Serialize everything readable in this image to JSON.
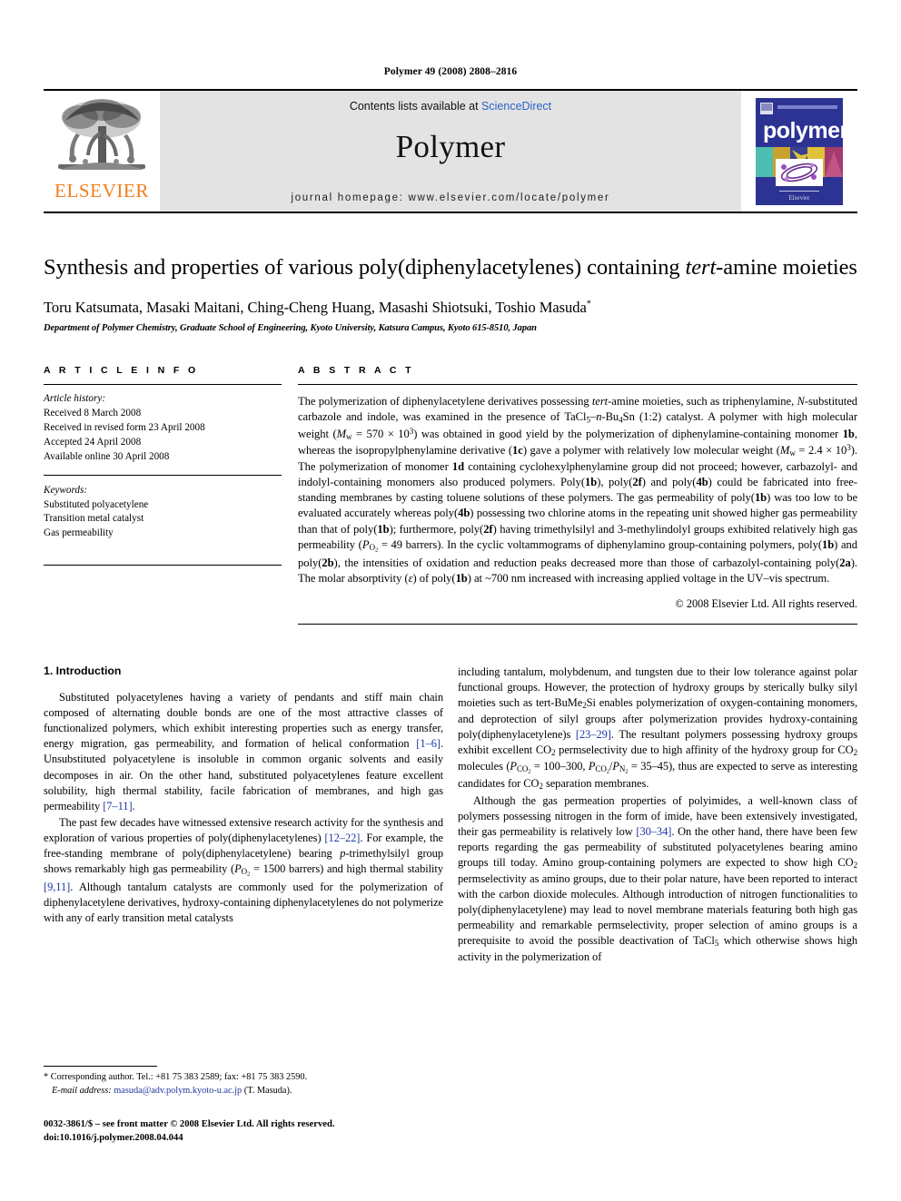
{
  "running_head": "Polymer 49 (2008) 2808–2816",
  "masthead": {
    "publisher_name": "ELSEVIER",
    "contents_prefix": "Contents lists available at ",
    "contents_link": "ScienceDirect",
    "journal_name": "Polymer",
    "homepage": "journal homepage: www.elsevier.com/locate/polymer",
    "cover_title": "polymer",
    "link_color": "#2b62c9",
    "elsevier_orange": "#F07F1A",
    "band_bg": "#e3e3e3"
  },
  "article": {
    "title_part1": "Synthesis and properties of various poly(diphenylacetylenes) containing ",
    "title_italic": "tert",
    "title_part2": "-amine moieties",
    "authors": "Toru Katsumata, Masaki Maitani, Ching-Cheng Huang, Masashi Shiotsuki, Toshio Masuda",
    "author_marker": "*",
    "affiliation": "Department of Polymer Chemistry, Graduate School of Engineering, Kyoto University, Katsura Campus, Kyoto 615-8510, Japan"
  },
  "article_info": {
    "heading": "A R T I C L E   I N F O",
    "history_label": "Article history:",
    "history": [
      "Received 8 March 2008",
      "Received in revised form 23 April 2008",
      "Accepted 24 April 2008",
      "Available online 30 April 2008"
    ],
    "keywords_label": "Keywords:",
    "keywords": [
      "Substituted polyacetylene",
      "Transition metal catalyst",
      "Gas permeability"
    ]
  },
  "abstract": {
    "heading": "A B S T R A C T",
    "copyright": "© 2008 Elsevier Ltd. All rights reserved."
  },
  "introduction": {
    "heading": "1. Introduction"
  },
  "footnotes": {
    "corresponding_marker": "*",
    "corresponding": "Corresponding author. Tel.: +81 75 383 2589; fax: +81 75 383 2590.",
    "email_label": "E-mail address:",
    "email": "masuda@adv.polym.kyoto-u.ac.jp",
    "email_owner": "(T. Masuda).",
    "imprint_line1": "0032-3861/$ – see front matter © 2008 Elsevier Ltd. All rights reserved.",
    "imprint_line2": "doi:10.1016/j.polymer.2008.04.044",
    "link_color": "#1d37a0"
  }
}
